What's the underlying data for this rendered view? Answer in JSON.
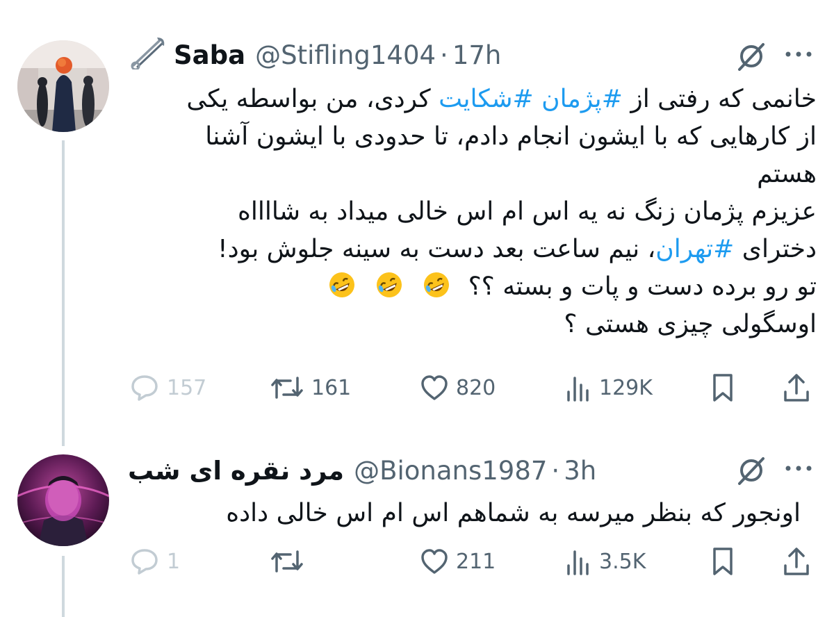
{
  "colors": {
    "text": "#0f1419",
    "muted": "#536471",
    "link": "#1d9bf0",
    "thread_line": "#cfd9de",
    "faded": "#c2ccd3"
  },
  "tweet1": {
    "name_icon": "safety-pin-icon",
    "name": "Saba",
    "handle": "@Stifling1404",
    "separator": "·",
    "time": "17h",
    "text": {
      "line1_a": "خانمی که رفتی از ",
      "tag1": "#پژمان",
      "tag2": "#شکایت",
      "line1_b": " کردی، من بواسطه یکی",
      "line2": "از کارهایی که با ایشون انجام دادم، تا حدودی با ایشون آشنا",
      "line3": "هستم",
      "line4": "عزیزم پژمان زنگ نه یه اس ام اس خالی میداد به شااااه",
      "line5_a": "دخترای ",
      "tag3": "#تهران",
      "line5_b": "، نیم ساعت بعد دست به سینه جلوش بود!",
      "line6": "تو رو برده دست و پات و بسته ؟؟",
      "line7": "اوسگولی چیزی هستی ؟"
    },
    "emoji_icon": "rolling-on-floor-laughing-emoji",
    "actions": {
      "replies": "157",
      "reposts": "161",
      "likes": "820",
      "views": "129K"
    }
  },
  "tweet2": {
    "name": "مرد نقره ای شب",
    "handle": "@Bionans1987",
    "separator": "·",
    "time": "3h",
    "text": "اونجور که بنظر میرسه به شماهم اس ام اس خالی داده",
    "actions": {
      "replies": "1",
      "reposts": "",
      "likes": "211",
      "views": "3.5K"
    }
  }
}
